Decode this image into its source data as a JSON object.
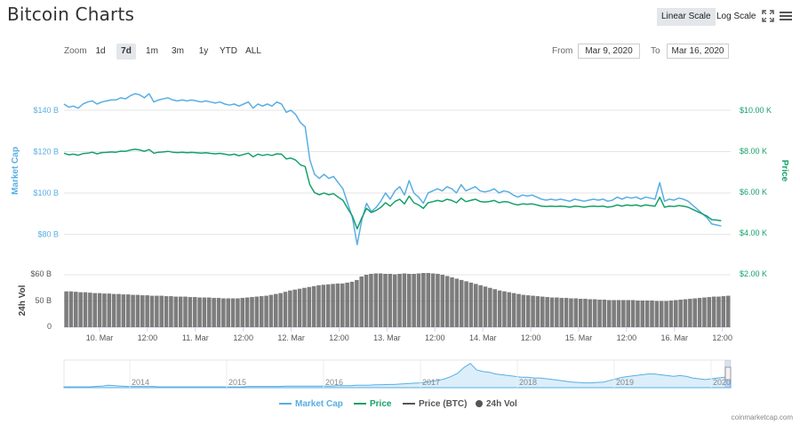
{
  "title": "Bitcoin Charts",
  "scale_buttons": {
    "linear": "Linear Scale",
    "log": "Log Scale"
  },
  "zoom": {
    "label": "Zoom",
    "buttons": [
      "1d",
      "7d",
      "1m",
      "3m",
      "1y",
      "YTD",
      "ALL"
    ],
    "active": "7d"
  },
  "range": {
    "from_label": "From",
    "from_value": "Mar 9, 2020",
    "to_label": "To",
    "to_value": "Mar 16, 2020"
  },
  "colors": {
    "market_cap": "#59aee3",
    "price": "#17a06a",
    "price_btc": "#555555",
    "volume": "#666666"
  },
  "chart_data": {
    "type": "line",
    "axes": {
      "left_title": "Market Cap",
      "right_title": "Price",
      "volume_title": "24h Vol",
      "left_ticks": [
        "$140 B",
        "$120 B",
        "$100 B",
        "$80 B"
      ],
      "right_ticks": [
        "$10.00 K",
        "$8.00 K",
        "$6.00 K",
        "$4.00 K",
        "$2.00 K"
      ],
      "volume_ticks": [
        "$60 B",
        "50 B",
        "0"
      ],
      "x_ticks": [
        "10. Mar",
        "12:00",
        "11. Mar",
        "12:00",
        "12. Mar",
        "12:00",
        "13. Mar",
        "12:00",
        "14. Mar",
        "12:00",
        "15. Mar",
        "12:00",
        "16. Mar",
        "12:00"
      ],
      "market_cap_range": [
        70,
        150
      ],
      "price_range": [
        1500,
        11000
      ],
      "volume_range": [
        0,
        62
      ]
    },
    "x": [
      0,
      0.05,
      0.1,
      0.15,
      0.2,
      0.25,
      0.3,
      0.35,
      0.4,
      0.45,
      0.5,
      0.55,
      0.6,
      0.65,
      0.7,
      0.75,
      0.8,
      0.85,
      0.9,
      0.95,
      1.0,
      1.05,
      1.1,
      1.15,
      1.2,
      1.25,
      1.3,
      1.35,
      1.4,
      1.45,
      1.5,
      1.55,
      1.6,
      1.65,
      1.7,
      1.75,
      1.8,
      1.85,
      1.9,
      1.95,
      2.0,
      2.05,
      2.1,
      2.15,
      2.2,
      2.25,
      2.3,
      2.35,
      2.4,
      2.45,
      2.5,
      2.55,
      2.6,
      2.65,
      2.7,
      2.75,
      2.8,
      2.85,
      2.9,
      2.95,
      3.0,
      3.05,
      3.1,
      3.15,
      3.2,
      3.25,
      3.3,
      3.35,
      3.4,
      3.45,
      3.5,
      3.55,
      3.6,
      3.65,
      3.7,
      3.75,
      3.8,
      3.85,
      3.9,
      3.95,
      4.0,
      4.05,
      4.1,
      4.15,
      4.2,
      4.25,
      4.3,
      4.35,
      4.4,
      4.45,
      4.5,
      4.55,
      4.6,
      4.65,
      4.7,
      4.75,
      4.8,
      4.85,
      4.9,
      4.95,
      5.0,
      5.05,
      5.1,
      5.15,
      5.2,
      5.25,
      5.3,
      5.35,
      5.4,
      5.45,
      5.5,
      5.55,
      5.6,
      5.65,
      5.7,
      5.75,
      5.8,
      5.85,
      5.9,
      5.95,
      6.0,
      6.05,
      6.1,
      6.15,
      6.2,
      6.25,
      6.3,
      6.35,
      6.4,
      6.45,
      6.5,
      6.55,
      6.6,
      6.65,
      6.7,
      6.75,
      6.8,
      6.85,
      6.9,
      6.95,
      7.0,
      7.05
    ],
    "series": [
      {
        "name": "Market Cap",
        "values": [
          143,
          141.5,
          142,
          141,
          143,
          144,
          144.5,
          143,
          144,
          144.5,
          145,
          145,
          146,
          145.5,
          147,
          148,
          147.5,
          146,
          148,
          144,
          145,
          145.5,
          146,
          145,
          144.5,
          145,
          144.5,
          145,
          144.5,
          144,
          144.5,
          144,
          143.5,
          144,
          143,
          142.5,
          143,
          142,
          143,
          144,
          141,
          143,
          142,
          143,
          142,
          144,
          143,
          139,
          140,
          138,
          134,
          132,
          116,
          109,
          107,
          109,
          107,
          108,
          105,
          102,
          95,
          88,
          75,
          87,
          95,
          91,
          93,
          96,
          100,
          97,
          101,
          103,
          99,
          106,
          100,
          98,
          95,
          100,
          101,
          102,
          101,
          103,
          102,
          100,
          104,
          101,
          102,
          103,
          101,
          100.5,
          101,
          102,
          100,
          101,
          100.5,
          99,
          98,
          99,
          98.5,
          99,
          98,
          97,
          96.5,
          97,
          96.5,
          97,
          96.5,
          96,
          97,
          96.5,
          96,
          96.5,
          97,
          96.5,
          97,
          96,
          96.5,
          98,
          97,
          98,
          97.5,
          98,
          97,
          98,
          97.5,
          97,
          105,
          96,
          97,
          96.5,
          97.5,
          97,
          96,
          94,
          92,
          90,
          88,
          85,
          84.5,
          84
        ]
      },
      {
        "name": "Price",
        "values": [
          7900,
          7820,
          7850,
          7800,
          7880,
          7900,
          7950,
          7870,
          7930,
          7940,
          7960,
          7950,
          8000,
          7990,
          8050,
          8090,
          8060,
          7990,
          8080,
          7900,
          7950,
          7960,
          7990,
          7950,
          7930,
          7950,
          7920,
          7940,
          7920,
          7900,
          7920,
          7890,
          7870,
          7890,
          7850,
          7810,
          7850,
          7780,
          7840,
          7900,
          7720,
          7850,
          7790,
          7840,
          7790,
          7870,
          7850,
          7620,
          7660,
          7560,
          7330,
          7250,
          6350,
          5970,
          5870,
          5950,
          5870,
          5920,
          5750,
          5600,
          5200,
          4820,
          4200,
          4750,
          5200,
          5000,
          5100,
          5250,
          5480,
          5310,
          5540,
          5650,
          5420,
          5800,
          5480,
          5370,
          5200,
          5480,
          5530,
          5590,
          5540,
          5650,
          5590,
          5480,
          5700,
          5530,
          5590,
          5650,
          5540,
          5510,
          5540,
          5590,
          5480,
          5530,
          5510,
          5420,
          5370,
          5420,
          5400,
          5420,
          5370,
          5310,
          5290,
          5310,
          5290,
          5310,
          5290,
          5260,
          5310,
          5290,
          5260,
          5290,
          5310,
          5290,
          5310,
          5260,
          5290,
          5370,
          5310,
          5370,
          5340,
          5370,
          5310,
          5370,
          5340,
          5310,
          5750,
          5260,
          5310,
          5290,
          5340,
          5310,
          5260,
          5150,
          5040,
          4930,
          4820,
          4650,
          4630,
          4600
        ]
      },
      {
        "name": "24h Vol",
        "values": [
          41,
          41,
          40.5,
          40,
          40,
          39.5,
          39,
          39,
          38.5,
          38.5,
          38,
          38,
          37.5,
          37.5,
          37,
          37,
          36.5,
          36.5,
          36,
          36,
          36,
          35.5,
          35.5,
          35,
          35,
          35,
          34.5,
          34.5,
          34,
          34,
          34,
          33.5,
          33.5,
          33,
          33,
          33,
          33,
          33.5,
          34,
          34.5,
          35,
          35.5,
          36,
          37,
          38,
          39,
          40.5,
          42,
          43,
          44,
          45,
          46,
          47,
          48,
          48.5,
          49,
          49.5,
          50,
          50,
          51,
          52,
          54,
          58,
          60,
          61,
          61.5,
          61.5,
          61,
          61,
          60.5,
          61,
          61.5,
          61,
          61,
          61.5,
          62,
          62,
          61.5,
          61,
          60,
          58.5,
          57,
          55.5,
          54,
          52.5,
          51,
          49.5,
          48,
          46.5,
          45,
          43.5,
          42,
          41,
          40,
          39,
          38,
          37,
          36.5,
          36,
          35.5,
          35,
          34.5,
          34,
          34,
          33.5,
          33.5,
          33,
          33,
          32.5,
          32.5,
          32,
          32,
          31.5,
          31.5,
          31,
          31,
          31,
          31,
          31,
          31,
          30.5,
          30.5,
          30.5,
          30.5,
          30,
          30,
          30,
          30.5,
          31,
          31.5,
          32,
          32.5,
          33,
          33.5,
          34,
          34.5,
          35,
          35,
          35.5,
          36
        ]
      }
    ],
    "navigator": {
      "x_labels": [
        "2014",
        "2015",
        "2016",
        "2017",
        "2018",
        "2019",
        "2020"
      ],
      "values": [
        1,
        1,
        1,
        1,
        1,
        1.5,
        2,
        3,
        2.5,
        2,
        1.5,
        1.5,
        1.5,
        1.5,
        1.5,
        1,
        1,
        1,
        1,
        1,
        1,
        1,
        1,
        1,
        1,
        1,
        1,
        1,
        1,
        1.5,
        1.5,
        1.5,
        1.5,
        1.5,
        1.5,
        2,
        2,
        2,
        2,
        2,
        2,
        2,
        2,
        2.5,
        2.5,
        2.5,
        3,
        3,
        3,
        3.5,
        3.5,
        4,
        4,
        4.5,
        5,
        5.5,
        6,
        7,
        8,
        9,
        11,
        14,
        18,
        25,
        30,
        22,
        20,
        19,
        17,
        16,
        15,
        14,
        13,
        13,
        12,
        12,
        11,
        10,
        9,
        8,
        7,
        6.5,
        6,
        6,
        6.5,
        7,
        9,
        11,
        13,
        14,
        15,
        16,
        17,
        17,
        16,
        15,
        14,
        15,
        14,
        12,
        11,
        10,
        11,
        12,
        13,
        14
      ]
    }
  },
  "legend": [
    {
      "label": "Market Cap",
      "kind": "line",
      "color": "#59aee3"
    },
    {
      "label": "Price",
      "kind": "line",
      "color": "#17a06a"
    },
    {
      "label": "Price (BTC)",
      "kind": "line",
      "color": "#555555"
    },
    {
      "label": "24h Vol",
      "kind": "dot",
      "color": "#555555"
    }
  ],
  "credit": "coinmarketcap.com"
}
